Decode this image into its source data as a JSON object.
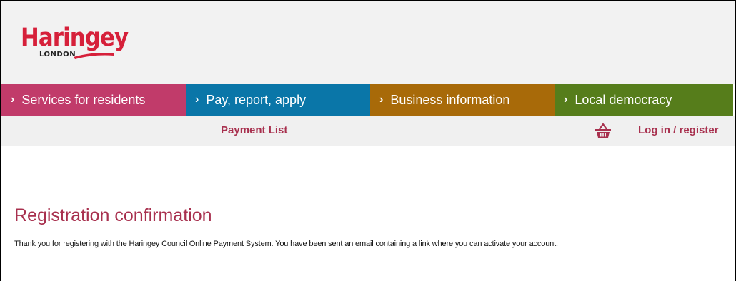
{
  "header": {
    "logo": {
      "name": "Haringey",
      "sub": "LONDON",
      "brand_color": "#d6203a"
    }
  },
  "nav": {
    "items": [
      {
        "label": "Services for residents",
        "color": "#c13b6a"
      },
      {
        "label": "Pay, report, apply",
        "color": "#0a76a8"
      },
      {
        "label": "Business information",
        "color": "#a86a09"
      },
      {
        "label": "Local democracy",
        "color": "#567d1b"
      }
    ],
    "chevron": "›"
  },
  "subnav": {
    "payment_list": "Payment List",
    "basket_icon": "basket-icon",
    "login": "Log in / register",
    "link_color": "#a8304e"
  },
  "main": {
    "title": "Registration confirmation",
    "message": "Thank you for registering with the Haringey Council Online Payment System. You have been sent an email containing a link where you can activate your account."
  }
}
